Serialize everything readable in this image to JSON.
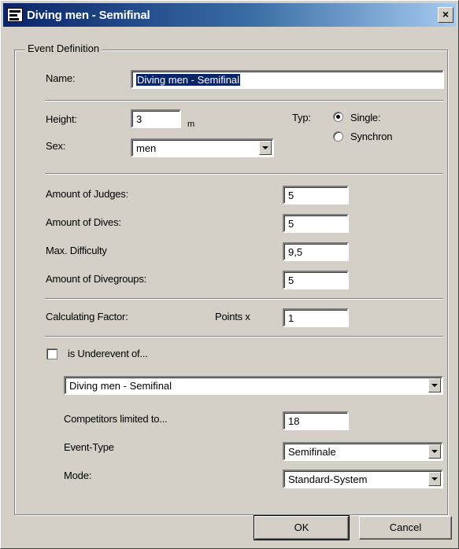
{
  "window": {
    "title": "Diving men - Semifinal",
    "close_label": "×"
  },
  "group": {
    "legend": "Event Definition"
  },
  "name": {
    "label": "Name:",
    "value": "Diving men - Semifinal"
  },
  "height": {
    "label": "Height:",
    "value": "3",
    "unit": "m"
  },
  "sex": {
    "label": "Sex:",
    "value": "men"
  },
  "type": {
    "label": "Typ:",
    "options": [
      "Single:",
      "Synchron"
    ],
    "selected": "Single:"
  },
  "judges": {
    "label": "Amount of Judges:",
    "value": "5"
  },
  "dives": {
    "label": "Amount of Dives:",
    "value": "5"
  },
  "difficulty": {
    "label": "Max. Difficulty",
    "value": "9,5"
  },
  "divegroups": {
    "label": "Amount of Divegroups:",
    "value": "5"
  },
  "factor": {
    "label": "Calculating Factor:",
    "points_label": "Points x",
    "value": "1"
  },
  "underevent": {
    "label": "is Underevent of...",
    "checked": false,
    "value": "Diving men - Semifinal"
  },
  "competitors": {
    "label": "Competitors limited to...",
    "value": "18"
  },
  "event_type": {
    "label": "Event-Type",
    "value": "Semifinale"
  },
  "mode": {
    "label": "Mode:",
    "value": "Standard-System"
  },
  "buttons": {
    "ok": "OK",
    "cancel": "Cancel"
  }
}
